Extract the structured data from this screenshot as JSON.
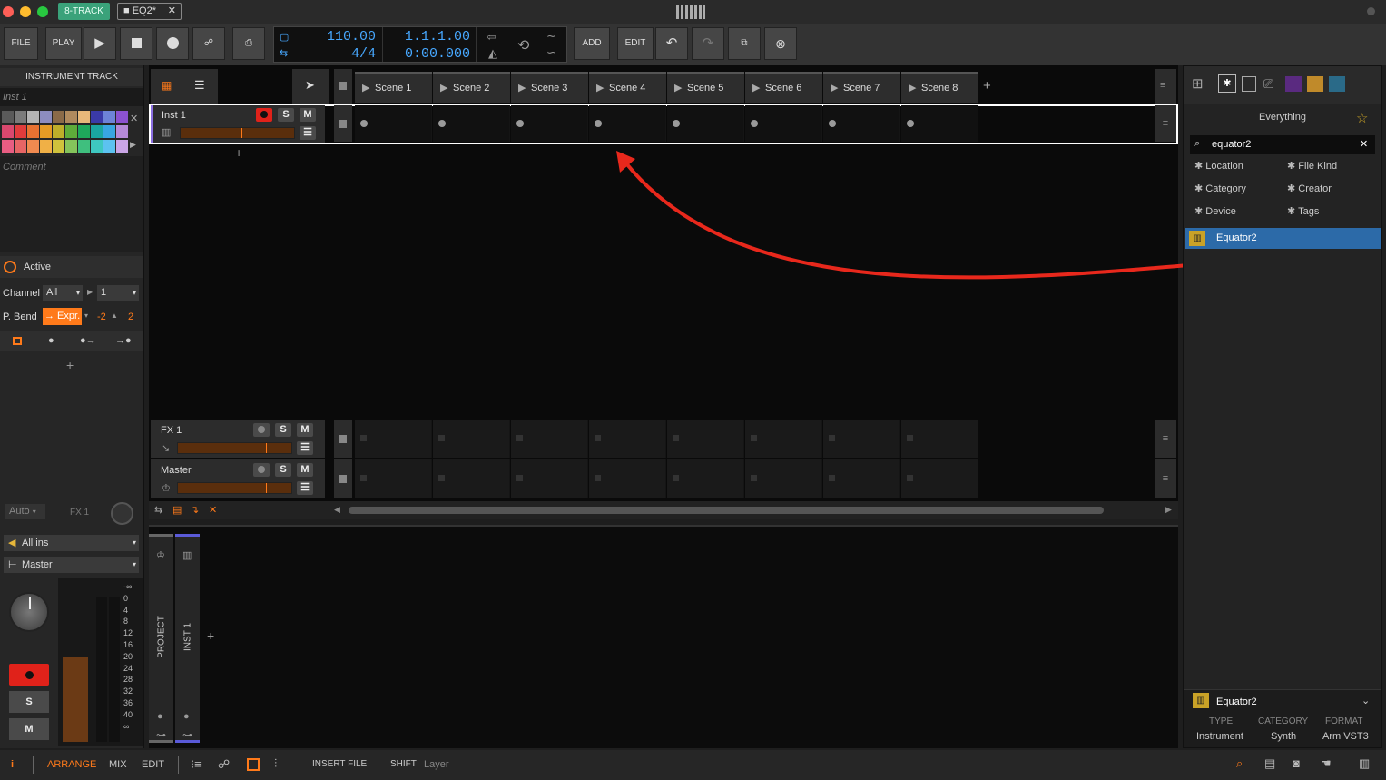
{
  "titlebar": {
    "badge": "8-TRACK",
    "doc_tab": "EQ2*",
    "close_glyph": "✕"
  },
  "toolbar": {
    "file": "FILE",
    "play": "PLAY",
    "add": "ADD",
    "edit": "EDIT",
    "tempo": "110.00",
    "time_sig": "4/4",
    "position_bars": "1.1.1.00",
    "position_time": "0:00.000"
  },
  "left_panel": {
    "header": "INSTRUMENT TRACK",
    "track_name": "Inst 1",
    "comment_placeholder": "Comment",
    "active_label": "Active",
    "channel_label": "Channel",
    "channel_value": "All",
    "channel_num": "1",
    "pbend_label": "P. Bend",
    "pbend_value": "→ Expr.",
    "pbend_down": "-2",
    "pbend_up": "2",
    "auto_label": "Auto",
    "fx_label": "FX 1",
    "input_label": "All ins",
    "output_label": "Master",
    "rec_label": "",
    "solo": "S",
    "mute": "M",
    "meter_scale": [
      "-∞",
      "0",
      "4",
      "8",
      "12",
      "16",
      "20",
      "24",
      "28",
      "32",
      "36",
      "40",
      "∞"
    ],
    "colors": [
      "#5a5a5a",
      "#7b7b7b",
      "#b5b5b5",
      "#8d8dbf",
      "#8a6a48",
      "#b08a5e",
      "#e8b87a",
      "#3a3aa8",
      "#6e83d8",
      "#8c52d0",
      "#d9486e",
      "#e03c3c",
      "#e87232",
      "#e59b25",
      "#bfae2a",
      "#5eab3a",
      "#1fa85b",
      "#1aa6a1",
      "#38a6e2",
      "#b58ad8",
      "#e85d82",
      "#e76565",
      "#f08a50",
      "#f0b046",
      "#cfc23c",
      "#84c35b",
      "#3fbf7e",
      "#3ec7c0",
      "#5cc2f0",
      "#caa5e6"
    ]
  },
  "tracks": [
    {
      "name": "Inst 1",
      "solo": "S",
      "mute": "M"
    },
    {
      "name": "FX 1",
      "solo": "S",
      "mute": "M"
    },
    {
      "name": "Master",
      "solo": "S",
      "mute": "M"
    }
  ],
  "scenes": [
    "Scene 1",
    "Scene 2",
    "Scene 3",
    "Scene 4",
    "Scene 5",
    "Scene 6",
    "Scene 7",
    "Scene 8"
  ],
  "bottom_panel": {
    "project_label": "PROJECT",
    "inst_label": "INST 1"
  },
  "browser": {
    "scope": "Everything",
    "search_value": "equator2",
    "filters": [
      "Location",
      "File Kind",
      "Category",
      "Creator",
      "Device",
      "Tags"
    ],
    "result": "Equator2",
    "detail_name": "Equator2",
    "type_label": "TYPE",
    "type_value": "Instrument",
    "category_label": "CATEGORY",
    "category_value": "Synth",
    "format_label": "FORMAT",
    "format_value": "Arm VST3"
  },
  "statusbar": {
    "info": "i",
    "arrange": "ARRANGE",
    "mix": "MIX",
    "edit": "EDIT",
    "insert_file": "INSERT FILE",
    "shift": "SHIFT",
    "layer": "Layer"
  },
  "accent": "#ff7a1a",
  "selection": "#2c6aa8"
}
